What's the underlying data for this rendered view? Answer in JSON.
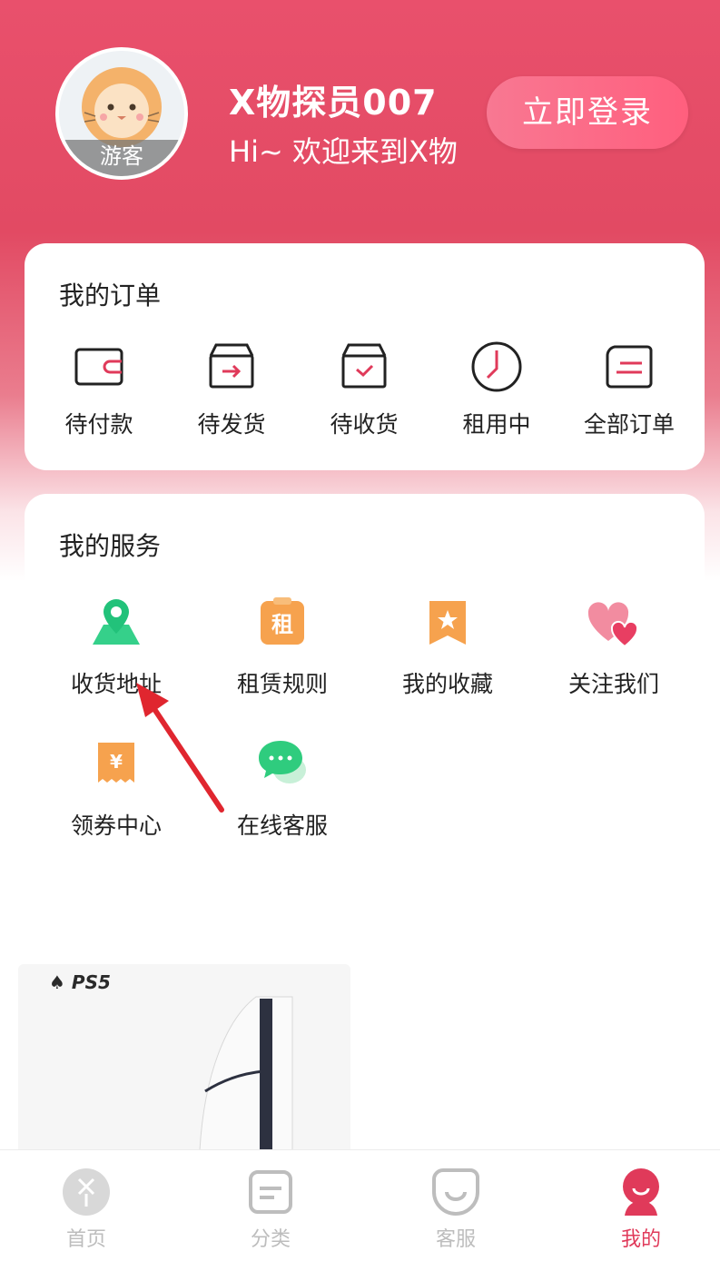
{
  "header": {
    "avatar_badge": "游客",
    "user_name": "X物探员007",
    "greeting": "Hi~ 欢迎来到X物",
    "login_button": "立即登录"
  },
  "orders": {
    "title": "我的订单",
    "items": [
      {
        "label": "待付款",
        "icon": "wallet-icon"
      },
      {
        "label": "待发货",
        "icon": "box-send-icon"
      },
      {
        "label": "待收货",
        "icon": "box-receive-icon"
      },
      {
        "label": "租用中",
        "icon": "clock-icon"
      },
      {
        "label": "全部订单",
        "icon": "order-list-icon"
      }
    ]
  },
  "services": {
    "title": "我的服务",
    "items": [
      {
        "label": "收货地址",
        "icon": "location-pin-icon"
      },
      {
        "label": "租赁规则",
        "icon": "rent-rule-icon",
        "glyph": "租"
      },
      {
        "label": "我的收藏",
        "icon": "star-bookmark-icon"
      },
      {
        "label": "关注我们",
        "icon": "hearts-icon"
      },
      {
        "label": "领券中心",
        "icon": "coupon-icon",
        "glyph": "¥"
      },
      {
        "label": "在线客服",
        "icon": "chat-bubble-icon"
      }
    ]
  },
  "product": {
    "brand": "PS5"
  },
  "tabbar": {
    "items": [
      {
        "label": "首页",
        "icon": "home-logo-icon"
      },
      {
        "label": "分类",
        "icon": "category-icon"
      },
      {
        "label": "客服",
        "icon": "service-face-icon"
      },
      {
        "label": "我的",
        "icon": "profile-icon"
      }
    ],
    "active_color": "#e03a5a"
  },
  "colors": {
    "brand": "#e24a63",
    "accent": "#ff5f7e"
  }
}
